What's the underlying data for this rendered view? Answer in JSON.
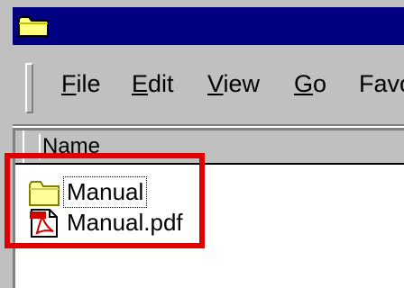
{
  "menu": {
    "items": [
      {
        "first": "F",
        "rest": "ile"
      },
      {
        "first": "E",
        "rest": "dit"
      },
      {
        "first": "V",
        "rest": "iew"
      },
      {
        "first": "G",
        "rest": "o"
      },
      {
        "first": "",
        "rest": "Favo"
      }
    ]
  },
  "list": {
    "column_name": "Name",
    "rows": [
      {
        "label": "Manual",
        "icon": "folder-icon"
      },
      {
        "label": "Manual.pdf",
        "icon": "pdf-file-icon"
      }
    ]
  },
  "colors": {
    "titlebar": "#000080",
    "face": "#c0c0c0",
    "highlight": "#e00000"
  }
}
